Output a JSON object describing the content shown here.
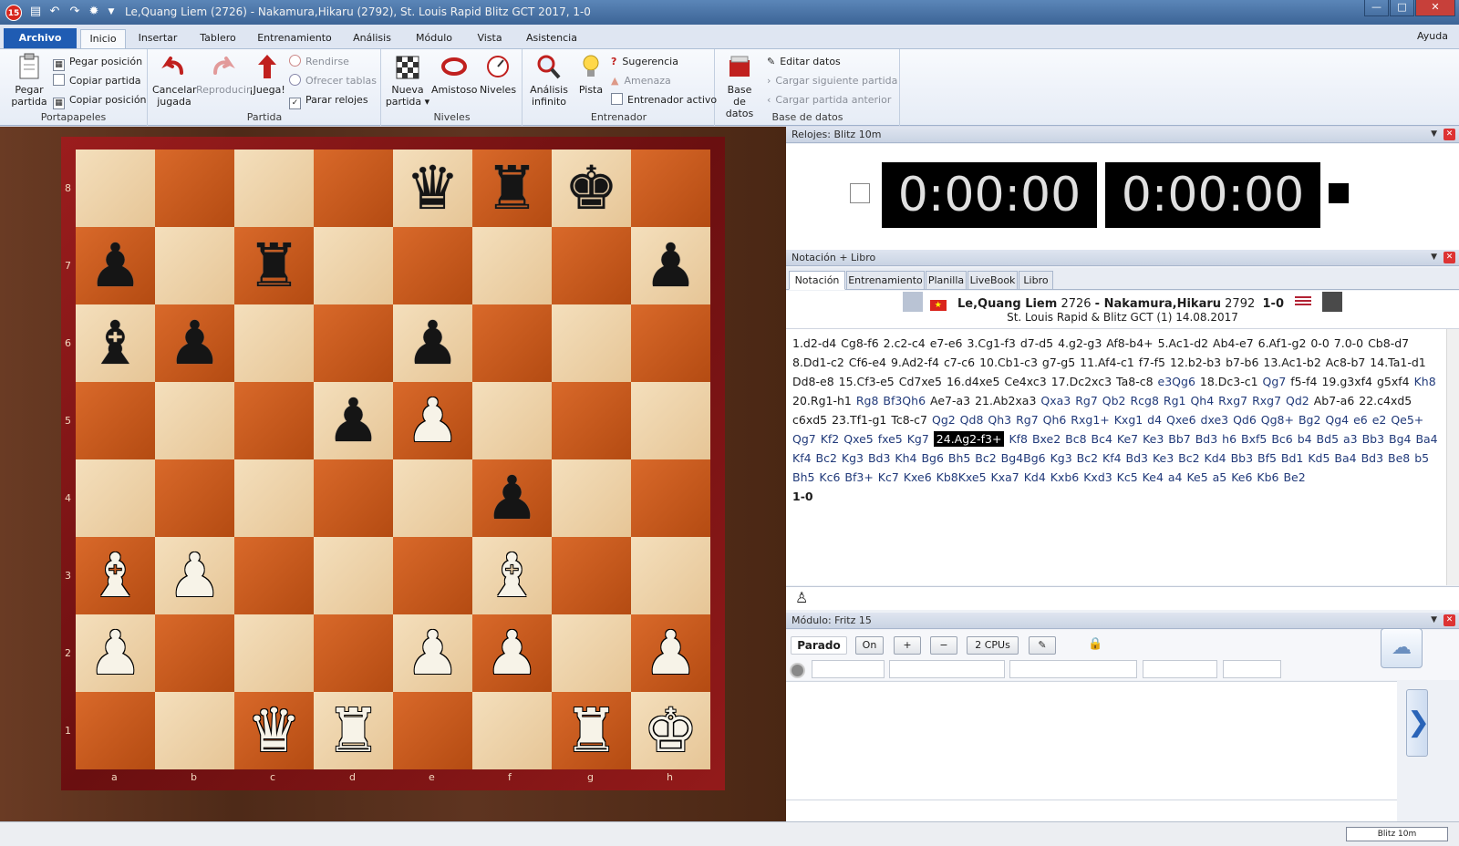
{
  "window": {
    "title": "Le,Quang Liem (2726) - Nakamura,Hikaru (2792), St. Louis Rapid  Blitz GCT 2017, 1-0",
    "app_badge": "15"
  },
  "ribbon_tabs": [
    "Archivo",
    "Inicio",
    "Insertar",
    "Tablero",
    "Entrenamiento",
    "Análisis",
    "Módulo",
    "Vista",
    "Asistencia"
  ],
  "help_label": "Ayuda",
  "groups": {
    "portapapeles": {
      "label": "Portapapeles",
      "big": "Pegar partida",
      "small": [
        "Pegar posición",
        "Copiar partida",
        "Copiar posición"
      ]
    },
    "partida": {
      "label": "Partida",
      "cancel": "Cancelar jugada",
      "replay": "Reproducir",
      "play": "¡Juega!",
      "small": [
        "Rendirse",
        "Ofrecer tablas",
        "Parar relojes"
      ]
    },
    "niveles": {
      "label": "Niveles",
      "new": "Nueva partida",
      "friendly": "Amistoso",
      "levels": "Niveles"
    },
    "entrenador": {
      "label": "Entrenador",
      "infinite": "Análisis infinito",
      "hint": "Pista",
      "small": [
        "Sugerencia",
        "Amenaza",
        "Entrenador activo"
      ]
    },
    "base": {
      "label": "Base de datos",
      "big": "Base de datos",
      "small": [
        "Editar datos",
        "Cargar siguiente partida",
        "Cargar partida anterior"
      ]
    }
  },
  "board": {
    "files": [
      "a",
      "b",
      "c",
      "d",
      "e",
      "f",
      "g",
      "h"
    ],
    "ranks": [
      "8",
      "7",
      "6",
      "5",
      "4",
      "3",
      "2",
      "1"
    ],
    "position": [
      [
        "",
        "",
        "",
        "",
        "bq",
        "br",
        "bk",
        ""
      ],
      [
        "bp",
        "",
        "br",
        "",
        "",
        "",
        "",
        "bp"
      ],
      [
        "bb",
        "bp",
        "",
        "",
        "bp",
        "",
        "",
        ""
      ],
      [
        "",
        "",
        "",
        "bp",
        "wp",
        "",
        "",
        ""
      ],
      [
        "",
        "",
        "",
        "",
        "",
        "bp",
        "",
        ""
      ],
      [
        "wb",
        "wp",
        "",
        "",
        "",
        "wb",
        "",
        ""
      ],
      [
        "wp",
        "",
        "",
        "",
        "wp",
        "wp",
        "",
        "wp"
      ],
      [
        "",
        "",
        "wq",
        "wr",
        "",
        "",
        "wr",
        "wk"
      ]
    ]
  },
  "clocks": {
    "title": "Relojes: Blitz 10m",
    "white_time": "0:00:00",
    "black_time": "0:00:00"
  },
  "notation": {
    "title": "Notación + Libro",
    "tabs": [
      "Notación",
      "Entrenamiento",
      "Planilla",
      "LiveBook",
      "Libro"
    ],
    "white": "Le,Quang Liem",
    "white_elo": "2726",
    "black": "Nakamura,Hikaru",
    "black_elo": "2792",
    "result": "1-0",
    "event": "St. Louis Rapid & Blitz GCT (1) 14.08.2017",
    "moves_a": "1.d2-d4  Cg8-f6  2.c2-c4  e7-e6  3.Cg1-f3  d7-d5  4.g2-g3  Af8-b4+  5.Ac1-d2  Ab4-e7  6.Af1-g2  0-0  7.0-0  Cb8-d7  8.Dd1-c2  Cf6-e4  9.Ad2-f4  c7-c6  10.Cb1-c3  g7-g5  11.Af4-c1  f7-f5  12.b2-b3  b7-b6  13.Ac1-b2  Ac8-b7  14.Ta1-d1  Dd8-e8  15.Cf3-e5  Cd7xe5  16.d4xe5  Ce4xc3  17.Dc2xc3  Ta8-c8",
    "var_1": "e3Qg6",
    "moves_b": "18.Dc3-c1",
    "var_2": "Qg7",
    "moves_c": "f5-f4  19.g3xf4  g5xf4",
    "var_3": "Kh8",
    "moves_d": "20.Rg1-h1",
    "var_4": "Rg8 Bf3Qh6",
    "moves_e": "Ae7-a3  21.Ab2xa3",
    "var_5": "Qxa3 Rg7 Qb2 Rcg8 Rg1 Qh4 Rxg7 Rxg7 Qd2",
    "moves_f": "Ab7-a6  22.c4xd5  c6xd5  23.Tf1-g1  Tc8-c7",
    "var_6": "Qg2 Qd8 Qh3 Rg7 Qh6 Rxg1+ Kxg1 d4 Qxe6 dxe3 Qd6 Qg8+ Bg2 Qg4 e6 e2 Qe5+ Qg7 Kf2 Qxe5 fxe5 Kg7",
    "current_move": "24.Ag2-f3+",
    "var_7": "Kf8 Bxe2 Bc8 Bc4 Ke7 Ke3 Bb7 Bd3 h6 Bxf5 Bc6 b4 Bd5 a3 Bb3 Bg4 Ba4 Kf4 Bc2 Kg3 Bd3 Kh4 Bg6 Bh5 Bc2 Bg4Bg6 Kg3 Bc2 Kf4 Bd3 Ke3 Bc2 Kd4 Bb3 Bf5 Bd1 Kd5 Ba4 Bd3 Be8 b5 Bh5 Kc6 Bf3+ Kc7 Kxe6 Kb8Kxe5 Kxa7 Kd4 Kxb6 Kxd3 Kc5 Ke4 a4 Ke5 a5 Ke6 Kb6 Be2",
    "final_result": "1-0"
  },
  "engine": {
    "title": "Módulo: Fritz 15",
    "status": "Parado",
    "on": "On",
    "cpus": "2 CPUs"
  },
  "statusbar": {
    "mode": "Blitz 10m"
  },
  "colors": {
    "accent": "#1f5cb3",
    "light_square": "#f1dab4",
    "dark_square": "#c9571c",
    "board_frame": "#8b1a1a"
  }
}
